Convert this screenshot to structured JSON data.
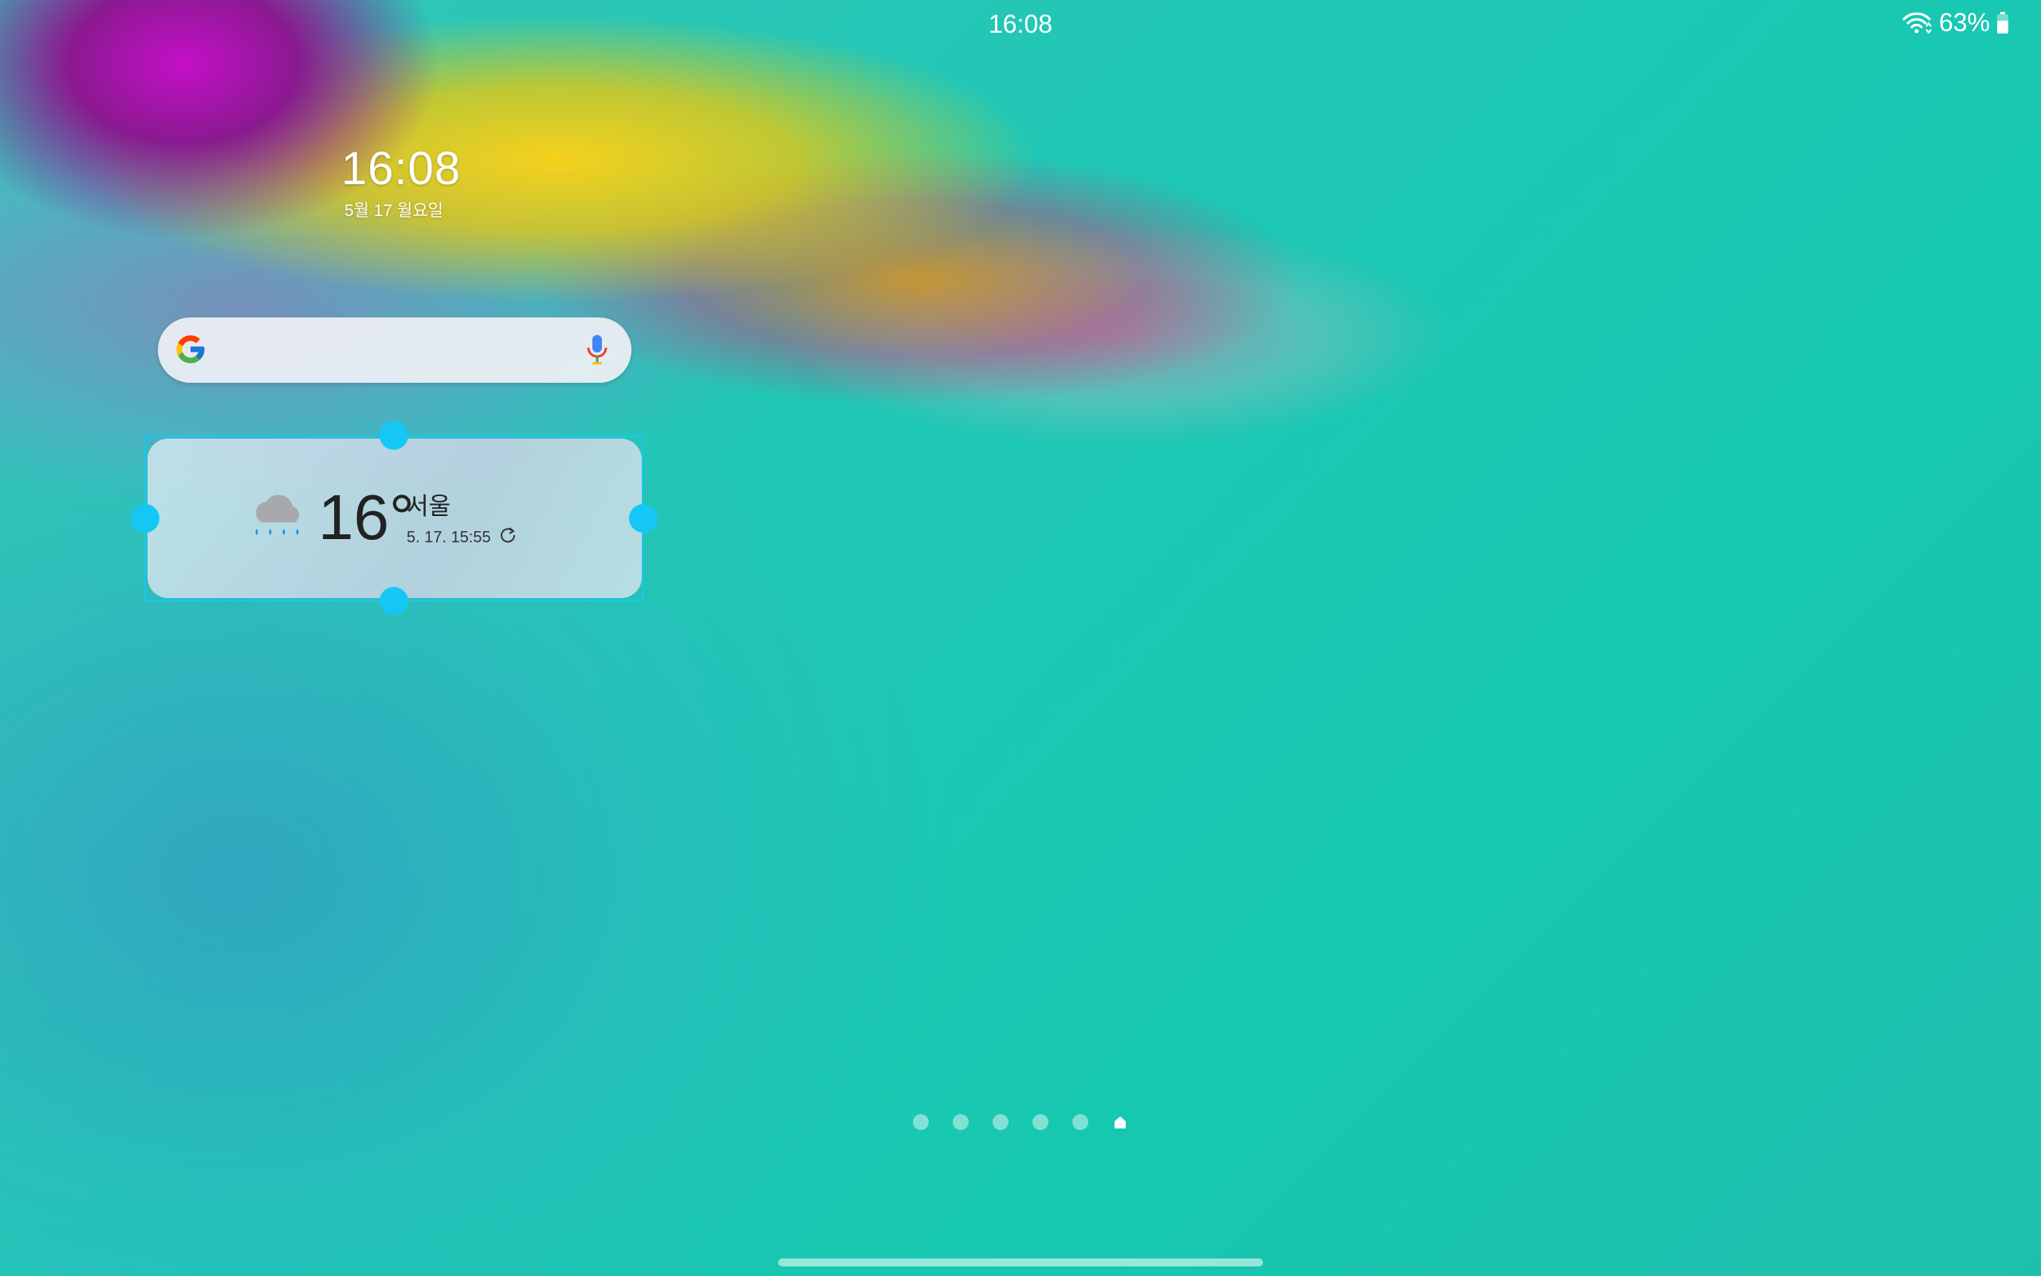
{
  "status_bar": {
    "time": "16:08",
    "battery": "63%",
    "icons": [
      "wifi-icon",
      "battery-icon"
    ]
  },
  "clock_widget": {
    "time": "16:08",
    "date": "5월 17 월요일"
  },
  "search_widget": {
    "icons": [
      "google-icon",
      "mic-icon"
    ]
  },
  "weather_widget": {
    "temperature": "16°",
    "city": "서울",
    "updated": "5. 17. 15:55",
    "icons": [
      "rain-cloud-icon",
      "refresh-icon"
    ],
    "accent_color": "#14c7f5"
  },
  "page_indicator": {
    "pages": 6,
    "current": 6,
    "current_icon": "home-icon"
  }
}
